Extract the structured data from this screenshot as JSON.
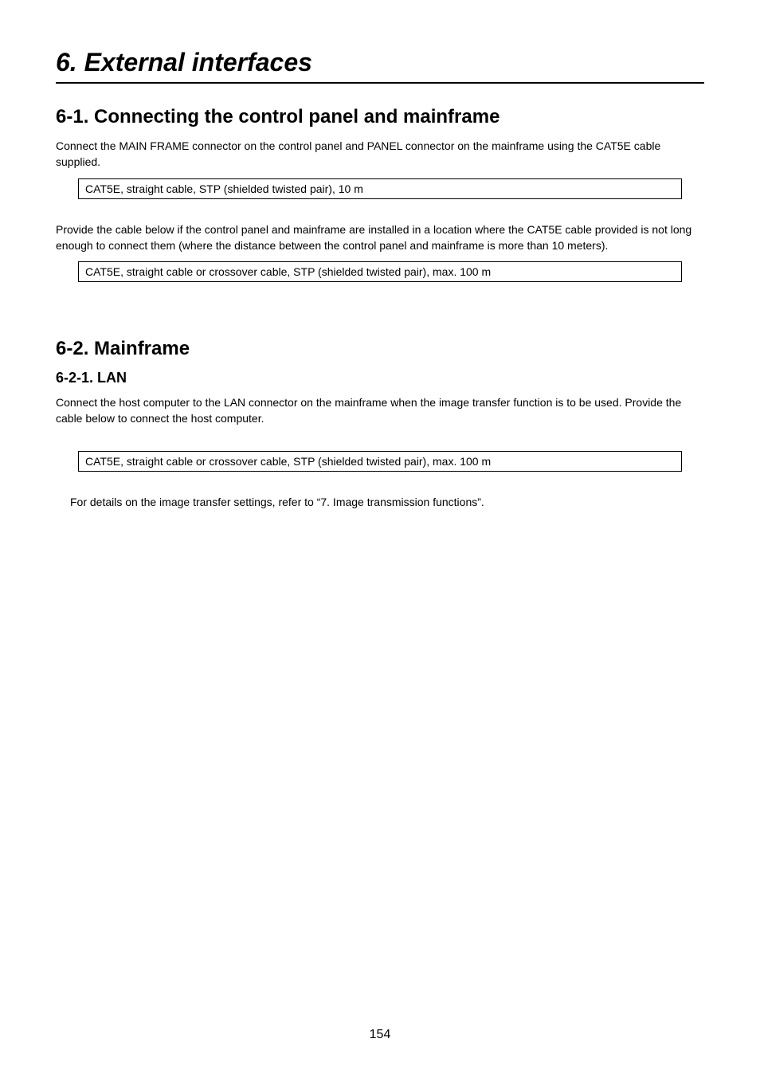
{
  "chapter": {
    "title": "6. External interfaces"
  },
  "section1": {
    "title": "6-1. Connecting the control panel and mainframe",
    "para1": "Connect the MAIN FRAME connector on the control panel and PANEL connector on the mainframe using the CAT5E cable supplied.",
    "spec1": "CAT5E, straight cable, STP (shielded twisted pair), 10 m",
    "para2": "Provide the cable below if the control panel and mainframe are installed in a location where the CAT5E cable provided is not long enough to connect them (where the distance between the control panel and mainframe is more than 10 meters).",
    "spec2": "CAT5E, straight cable or crossover cable, STP (shielded twisted pair), max. 100 m"
  },
  "section2": {
    "title": "6-2. Mainframe",
    "subsection1": {
      "title": "6-2-1.  LAN",
      "para1": "Connect the host computer to the LAN connector on the mainframe when the image transfer function is to be used. Provide the cable below to connect the host computer.",
      "spec1": "CAT5E, straight cable or crossover cable, STP (shielded twisted pair), max. 100 m",
      "note": "For details on the image transfer settings, refer to “7. Image transmission functions”."
    }
  },
  "pageNumber": "154"
}
